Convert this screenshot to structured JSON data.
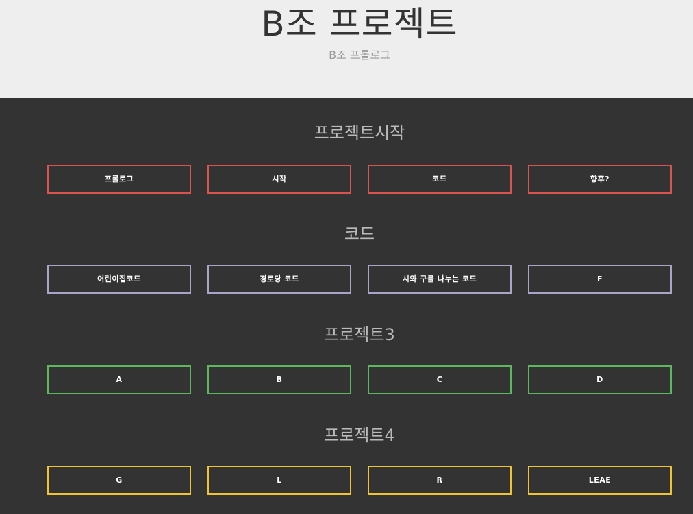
{
  "header": {
    "title": "B조 프로젝트",
    "subtitle": "B조 프롤로그"
  },
  "sections": [
    {
      "title": "프로젝트시작",
      "border_color": "#d9534f",
      "buttons": [
        "프롤로그",
        "시작",
        "코드",
        "향후?"
      ]
    },
    {
      "title": "코드",
      "border_color": "#a9a5c9",
      "buttons": [
        "어린이집코드",
        "경로당 코드",
        "시와 구를 나누는 코드",
        "F"
      ]
    },
    {
      "title": "프로젝트3",
      "border_color": "#5cb85c",
      "buttons": [
        "A",
        "B",
        "C",
        "D"
      ]
    },
    {
      "title": "프로젝트4",
      "border_color": "#f0c330",
      "buttons": [
        "G",
        "L",
        "R",
        "LEAE"
      ]
    }
  ]
}
